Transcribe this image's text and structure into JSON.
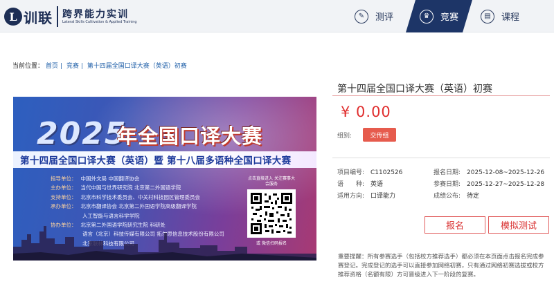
{
  "header": {
    "logo_mark": "L",
    "logo_brand": "训联",
    "logo_cn": "跨界能力实训",
    "logo_en": "Lateral Skills Cultivation & Applied Training",
    "nav": [
      {
        "label": "测评",
        "icon": "quiz-icon",
        "glyph": "✎"
      },
      {
        "label": "竞赛",
        "icon": "trophy-icon",
        "glyph": "♛"
      },
      {
        "label": "课程",
        "icon": "course-icon",
        "glyph": "▤"
      }
    ]
  },
  "breadcrumb": {
    "prefix": "当前位置：",
    "items": [
      "首页",
      "竞赛",
      "第十四届全国口译大赛（英语）初赛"
    ]
  },
  "banner": {
    "year": "2025",
    "title": "年全国口译大赛",
    "subtitle": "第十四届全国口译大赛（英语）暨 第十八届多语种全国口译大赛",
    "orgs": [
      {
        "k": "指导单位：",
        "v": "中国外文局   中国翻译协会"
      },
      {
        "k": "主办单位：",
        "v": "当代中国与世界研究院   北京第二外国语学院"
      },
      {
        "k": "支持单位：",
        "v": "北京市科学技术委员会、中关村科技园区管理委员会"
      },
      {
        "k": "承办单位：",
        "v": "北京市翻译协会   北京第二外国语学院高级翻译学院"
      },
      {
        "k": "",
        "v": "人工智能与语言科学学院"
      },
      {
        "k": "协办单位：",
        "v": "北京第二外国语学院研究生院   科研处"
      },
      {
        "k": "",
        "v": "语言（北京）科技传媒有限公司   拓尔思信息技术股份有限公司"
      },
      {
        "k": "",
        "v": "北京联林科技有限公司"
      }
    ],
    "qr_caption": "点击直接进入 关注赛事大会服务",
    "qr_foot": "或 微信扫码报名"
  },
  "contest": {
    "title": "第十四届全国口译大赛（英语）初赛",
    "price": "¥ 0.00",
    "group_label": "组别:",
    "group_value": "交传组",
    "info": {
      "code_k": "项目编号:",
      "code_v": "C1102526",
      "reg_k": "报名日期:",
      "reg_v": "2025-12-08~2025-12-26",
      "lang_k": "语　　种:",
      "lang_v": "英语",
      "part_k": "参赛日期:",
      "part_v": "2025-12-27~2025-12-28",
      "dir_k": "适用方向:",
      "dir_v": "口译能力",
      "res_k": "成绩公布:",
      "res_v": "待定"
    },
    "btn_register": "报名",
    "btn_mock": "模拟测试",
    "notice": "重要提醒：所有参赛选手（包括校方推荐选手）都必须在本页面点击报名完成参赛登记。完成登记的选手可以直接参加网络初赛，只有通过网络初赛选拔或校方推荐资格（名额有限）方可晋级进入下一阶段的复赛。"
  }
}
